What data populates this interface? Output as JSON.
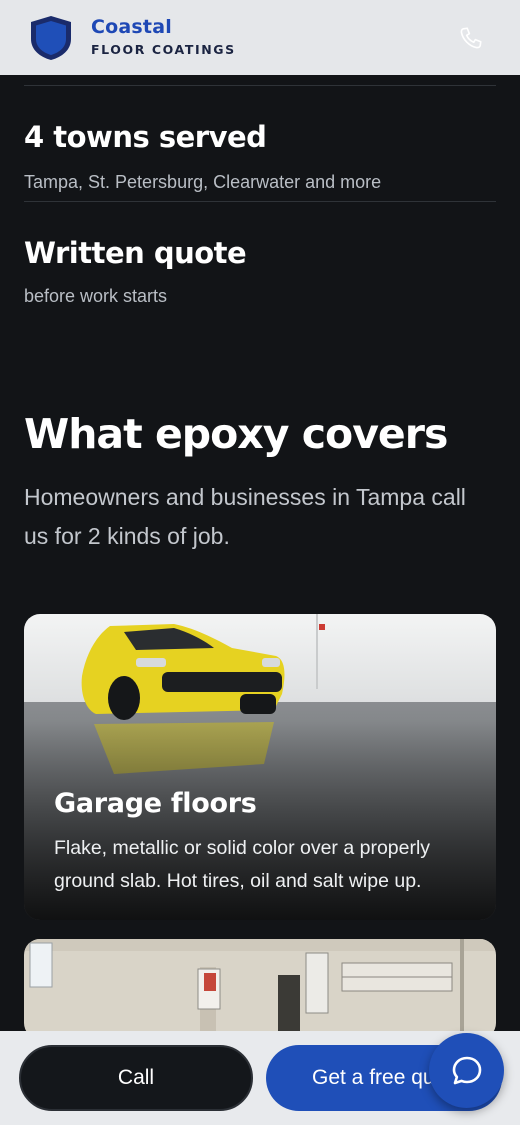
{
  "header": {
    "brand_name": "Coastal",
    "brand_sub": "FLOOR COATINGS",
    "logo_icon": "shield-logo-icon",
    "phone_icon": "phone-icon"
  },
  "stats": [
    {
      "title": "4 towns served",
      "subtitle": "Tampa, St. Petersburg, Clearwater and more"
    },
    {
      "title": "Written quote",
      "subtitle": "before work starts"
    }
  ],
  "section": {
    "title": "What epoxy covers",
    "lead": "Homeowners and businesses in Tampa call us for 2 kinds of job."
  },
  "cards": [
    {
      "title": "Garage floors",
      "description": "Flake, metallic or solid color over a properly ground slab. Hot tires, oil and salt wipe up."
    }
  ],
  "bottom_bar": {
    "call_label": "Call",
    "quote_label": "Get a free quote",
    "chat_icon": "chat-bubble-icon"
  },
  "colors": {
    "background": "#121417",
    "brand_blue": "#1f4fb8",
    "header_bg": "#e5e7ea"
  }
}
